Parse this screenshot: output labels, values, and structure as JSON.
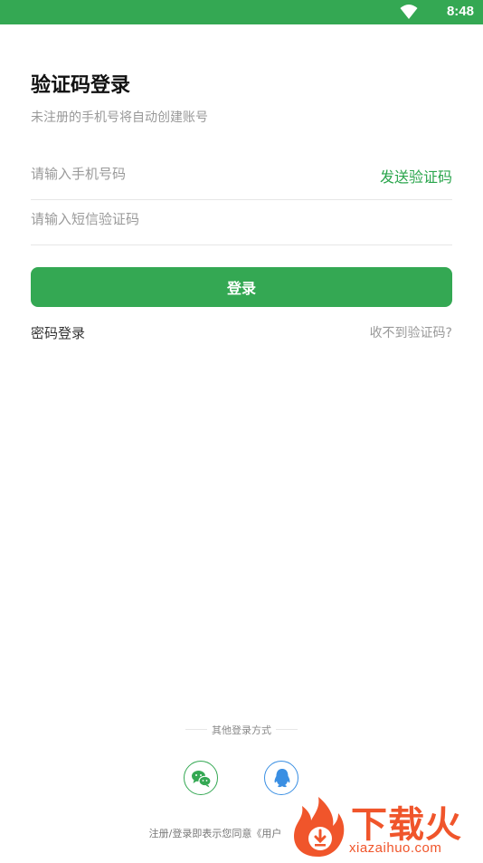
{
  "status_bar": {
    "time": "8:48"
  },
  "header": {
    "title": "验证码登录",
    "subtitle": "未注册的手机号将自动创建账号"
  },
  "form": {
    "phone_placeholder": "请输入手机号码",
    "send_code_label": "发送验证码",
    "code_placeholder": "请输入短信验证码",
    "login_label": "登录"
  },
  "links": {
    "password_login": "密码登录",
    "no_code": "收不到验证码?"
  },
  "other_login": {
    "label": "其他登录方式",
    "options": [
      "wechat-icon",
      "qq-icon"
    ]
  },
  "agreement": {
    "text": "注册/登录即表示您同意《用户"
  },
  "watermark": {
    "brand": "下载火",
    "url": "xiazaihuo.com"
  },
  "colors": {
    "accent": "#34a853",
    "link_green": "#2aa54c",
    "qq_blue": "#3a8fe3",
    "watermark": "#f0552b"
  }
}
